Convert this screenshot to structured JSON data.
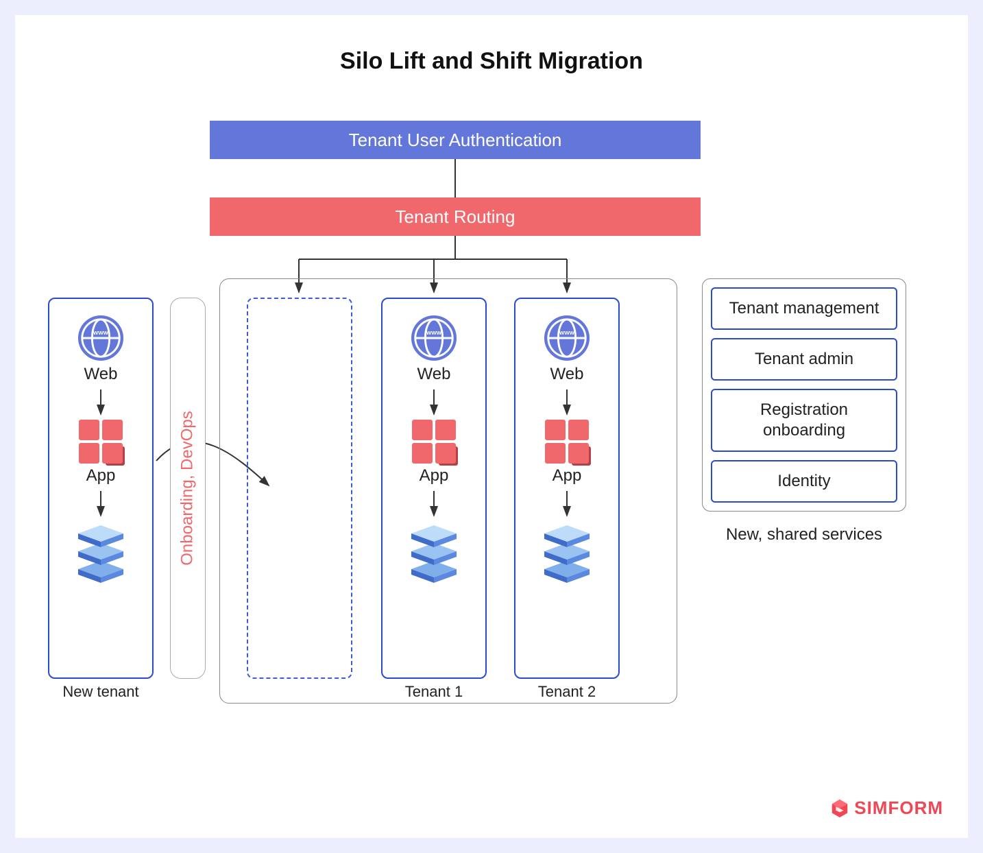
{
  "title": "Silo Lift and Shift Migration",
  "bars": {
    "auth": "Tenant User Authentication",
    "routing": "Tenant Routing"
  },
  "onboarding_label": "Onboarding, DevOps",
  "stack": {
    "web": "Web",
    "app": "App"
  },
  "captions": {
    "new_tenant": "New tenant",
    "tenant_1": "Tenant 1",
    "tenant_2": "Tenant 2",
    "services": "New, shared services"
  },
  "services": {
    "tenant_management": "Tenant management",
    "tenant_admin": "Tenant admin",
    "registration": "Registration onboarding",
    "identity": "Identity"
  },
  "brand": "SIMFORM"
}
